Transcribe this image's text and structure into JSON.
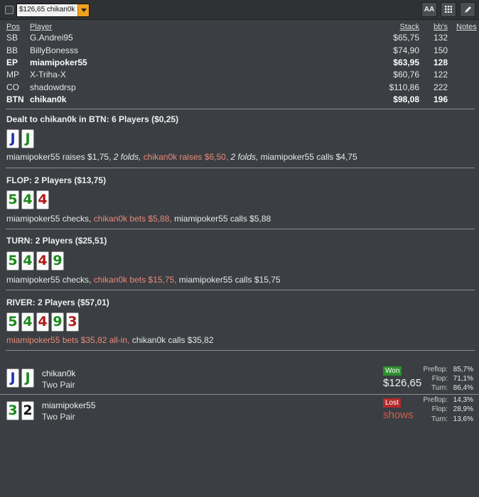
{
  "toolbar": {
    "hand_select_value": "$126,65 chikan0k",
    "font_button_label": "AA",
    "grid_icon": "grid-icon",
    "edit_icon": "pencil-icon"
  },
  "table": {
    "headers": {
      "pos": "Pos",
      "player": "Player",
      "stack": "Stack",
      "bbs": "bb's",
      "notes": "Notes"
    },
    "rows": [
      {
        "pos": "SB",
        "player": "G.Andrei95",
        "stack": "$65,75",
        "bbs": "132"
      },
      {
        "pos": "BB",
        "player": "BillyBonesss",
        "stack": "$74,90",
        "bbs": "150"
      },
      {
        "pos": "EP",
        "player": "miamipoker55",
        "stack": "$63,95",
        "bbs": "128"
      },
      {
        "pos": "MP",
        "player": "X-Triha-X",
        "stack": "$60,76",
        "bbs": "122"
      },
      {
        "pos": "CO",
        "player": "shadowdrsp",
        "stack": "$110,86",
        "bbs": "222"
      },
      {
        "pos": "BTN",
        "player": "chikan0k",
        "stack": "$98,08",
        "bbs": "196"
      }
    ]
  },
  "preflop": {
    "title": "Dealt to chikan0k in BTN: 6 Players ($0,25)",
    "cards": [
      "J",
      "J"
    ],
    "action": {
      "a1": "miamipoker55 raises $1,75, ",
      "a2": "2 folds,",
      "a3": " chikan0k raises $6,50,",
      "a4": " 2 folds,",
      "a5": " miamipoker55 calls $4,75"
    }
  },
  "flop": {
    "title": "FLOP: 2 Players ($13,75)",
    "cards": [
      "5",
      "4",
      "4"
    ],
    "action": {
      "a1": "miamipoker55 checks, ",
      "a2": "chikan0k bets $5,88,",
      "a3": " miamipoker55 calls $5,88"
    }
  },
  "turn": {
    "title": "TURN: 2 Players ($25,51)",
    "cards": [
      "5",
      "4",
      "4",
      "9"
    ],
    "action": {
      "a1": "miamipoker55 checks, ",
      "a2": "chikan0k bets $15,75,",
      "a3": " miamipoker55 calls $15,75"
    }
  },
  "river": {
    "title": "RIVER: 2 Players ($57,01)",
    "cards": [
      "5",
      "4",
      "4",
      "9",
      "3"
    ],
    "action": {
      "a1": "miamipoker55 bets $35,82 all-in,",
      "a2": " chikan0k calls $35,82"
    }
  },
  "results": [
    {
      "cards": [
        "J",
        "J"
      ],
      "name": "chikan0k",
      "hand": "Two Pair",
      "badge": "Won",
      "amount": "$126,65",
      "equity": {
        "preflop_label": "Preflop:",
        "preflop": "85,7%",
        "flop_label": "Flop:",
        "flop": "71,1%",
        "turn_label": "Turn:",
        "turn": "86,4%"
      }
    },
    {
      "cards": [
        "3",
        "2"
      ],
      "name": "miamipoker55",
      "hand": "Two Pair",
      "badge": "Lost",
      "amount": "shows",
      "equity": {
        "preflop_label": "Preflop:",
        "preflop": "14,3%",
        "flop_label": "Flop:",
        "flop": "28,9%",
        "turn_label": "Turn:",
        "turn": "13,6%"
      }
    }
  ],
  "colors": {
    "background": "#3b3e42",
    "hero_action": "#e98a7a",
    "won_badge": "#2f8f2f",
    "lost_badge": "#b52a2a",
    "spade": "#111111",
    "heart": "#b01a1a",
    "club": "#1a8a1a",
    "diamond": "#1b2fb0"
  }
}
